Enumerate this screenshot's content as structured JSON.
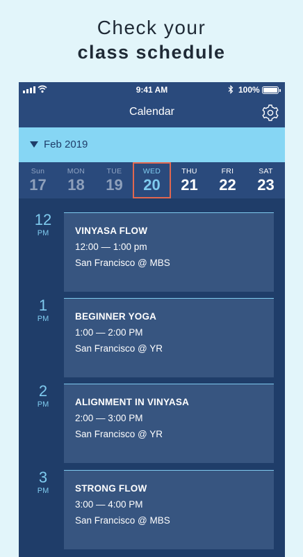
{
  "headline": {
    "line1": "Check your",
    "line2": "class schedule"
  },
  "status_bar": {
    "time": "9:41 AM",
    "battery": "100%"
  },
  "nav": {
    "title": "Calendar"
  },
  "month": {
    "label": "Feb 2019"
  },
  "week": [
    {
      "name": "Sun",
      "date": "17",
      "state": "past"
    },
    {
      "name": "MON",
      "date": "18",
      "state": "past"
    },
    {
      "name": "TUE",
      "date": "19",
      "state": "past"
    },
    {
      "name": "WED",
      "date": "20",
      "state": "selected"
    },
    {
      "name": "THU",
      "date": "21",
      "state": "future"
    },
    {
      "name": "FRI",
      "date": "22",
      "state": "future"
    },
    {
      "name": "SAT",
      "date": "23",
      "state": "future"
    }
  ],
  "classes": [
    {
      "hour": "12",
      "ampm": "PM",
      "name": "VINYASA FLOW",
      "time": "12:00 — 1:00 pm",
      "location": "San Francisco @ MBS"
    },
    {
      "hour": "1",
      "ampm": "PM",
      "name": "BEGINNER YOGA",
      "time": "1:00 — 2:00 PM",
      "location": "San Francisco @ YR"
    },
    {
      "hour": "2",
      "ampm": "PM",
      "name": "ALIGNMENT IN VINYASA",
      "time": "2:00 — 3:00 PM",
      "location": "San Francisco @ YR"
    },
    {
      "hour": "3",
      "ampm": "PM",
      "name": "STRONG FLOW",
      "time": "3:00 — 4:00 PM",
      "location": "San Francisco @ MBS"
    }
  ],
  "colors": {
    "background": "#e2f5fa",
    "app_dark": "#1f3d69",
    "header": "#2a4a7c",
    "month_bar": "#86d6f4",
    "accent": "#7fcbef",
    "selected_border": "#e2674f",
    "card": "#375580"
  },
  "icons": [
    "signal-icon",
    "wifi-icon",
    "bluetooth-icon",
    "battery-icon",
    "gear-icon",
    "caret-down-icon"
  ]
}
